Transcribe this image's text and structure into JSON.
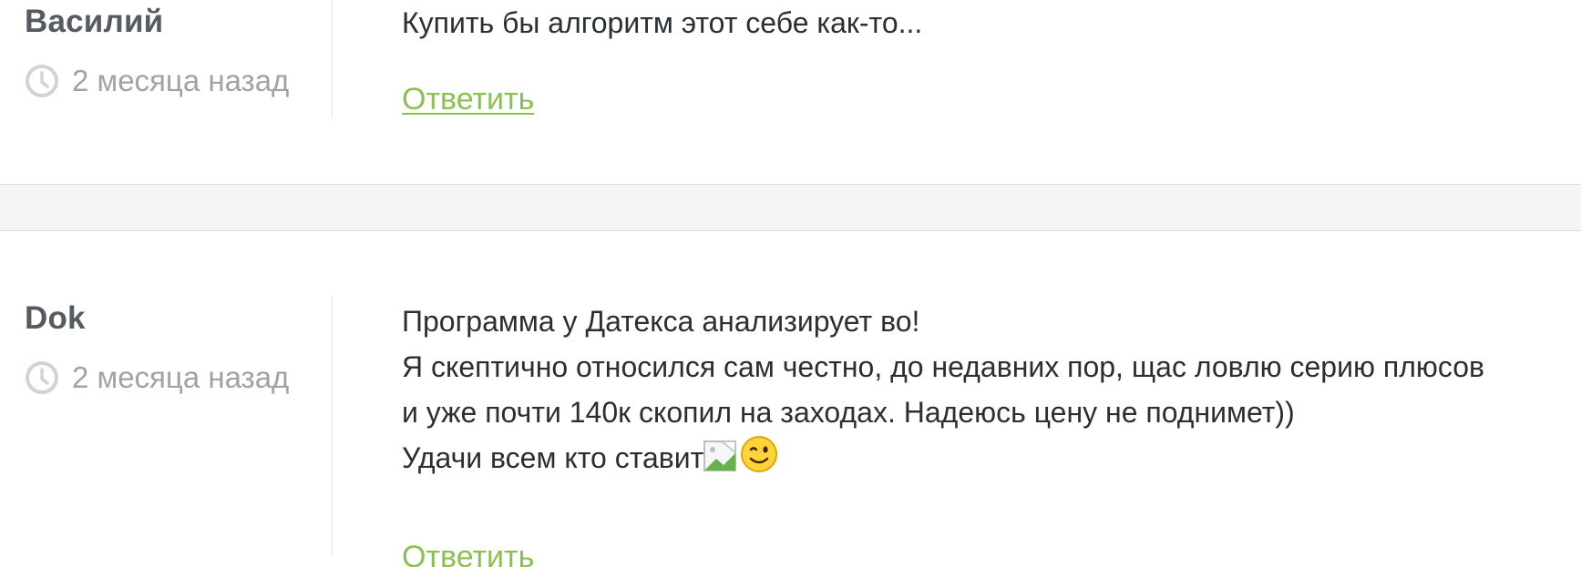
{
  "comments": [
    {
      "author": "Василий",
      "time": "2 месяца назад",
      "lines": [
        "Купить бы алгоритм этот себе как-то..."
      ],
      "reply_label": "Ответить"
    },
    {
      "author": "Dok",
      "time": "2 месяца назад",
      "lines": [
        "Программа у Датекса анализирует во!",
        "Я скептично относился сам честно, до недавних пор, щас ловлю серию плюсов",
        "и уже почти 140к скопил на заходах. Надеюсь цену не поднимет))",
        "Удачи всем кто ставит"
      ],
      "reply_label": "Ответить",
      "inline_icons": [
        "broken-image-icon",
        "wink-emoji-icon"
      ]
    }
  ],
  "colors": {
    "author": "#555b61",
    "meta": "#9ea3a8",
    "text": "#2a2f34",
    "link": "#8cc152",
    "separator": "#f5f5f5"
  }
}
